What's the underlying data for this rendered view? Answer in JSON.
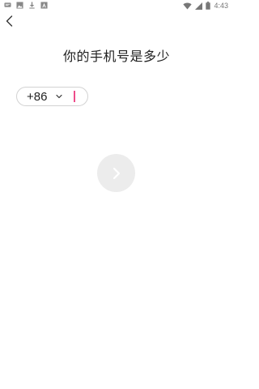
{
  "status_bar": {
    "time": "4:43",
    "battery_glyph": "8",
    "left_icons": [
      "message-icon",
      "image-icon",
      "download-icon",
      "app-icon"
    ],
    "right_icons": [
      "wifi-icon",
      "signal-icon",
      "battery-icon"
    ]
  },
  "header": {
    "back_icon": "chevron-left-icon"
  },
  "main": {
    "title": "你的手机号是多少",
    "phone": {
      "country_code": "+86",
      "value": "",
      "placeholder": ""
    },
    "next_icon": "chevron-right-icon"
  },
  "colors": {
    "cursor": "#ee4d8a",
    "next_button_bg": "#ececec",
    "field_border": "#d2d2d2"
  }
}
